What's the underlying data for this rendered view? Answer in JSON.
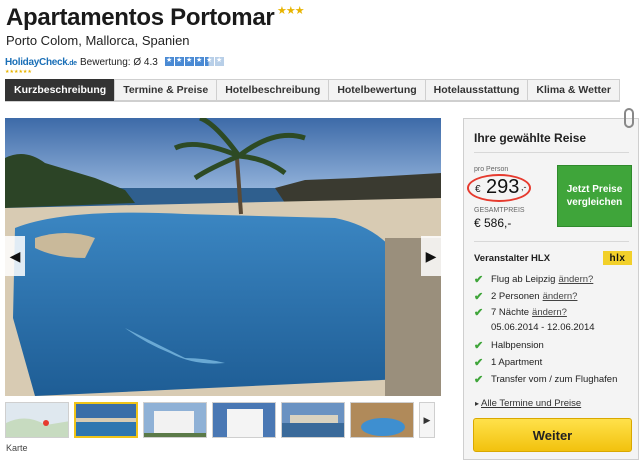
{
  "hotel": {
    "name": "Apartamentos Portomar",
    "stars": "★★★",
    "location": "Porto Colom, Mallorca, Spanien"
  },
  "rating": {
    "logo_text": "HolidayCheck",
    "logo_suffix": ".de",
    "label": "Bewertung: Ø 4.3",
    "value": 4.3,
    "max": 6
  },
  "tabs": [
    {
      "label": "Kurzbeschreibung",
      "active": true
    },
    {
      "label": "Termine & Preise",
      "active": false
    },
    {
      "label": "Hotelbeschreibung",
      "active": false
    },
    {
      "label": "Hotelbewertung",
      "active": false
    },
    {
      "label": "Hotelausstattung",
      "active": false
    },
    {
      "label": "Klima & Wetter",
      "active": false
    }
  ],
  "gallery": {
    "prev_icon": "chevron-left-icon",
    "next_icon": "chevron-right-icon",
    "thumbnail_caption": "Karte",
    "more_icon": "chevron-right-icon"
  },
  "booking": {
    "title": "Ihre gewählte Reise",
    "per_person_label": "pro Person",
    "currency": "€",
    "price_per_person": "293",
    "price_cents": ",-",
    "total_label": "GESAMTPREIS",
    "total_value": "€ 586,-",
    "compare_button": "Jetzt Preise vergleichen",
    "organizer_label": "Veranstalter HLX",
    "organizer_logo": "hlx",
    "features": [
      {
        "text": "Flug ab Leipzig",
        "change": "ändern?"
      },
      {
        "text": "2 Personen",
        "change": "ändern?"
      },
      {
        "text": "7 Nächte",
        "change": "ändern?"
      },
      {
        "text": "Halbpension",
        "change": ""
      },
      {
        "text": "1 Apartment",
        "change": ""
      },
      {
        "text": "Transfer vom / zum Flughafen",
        "change": ""
      }
    ],
    "date_range": "05.06.2014 - 12.06.2014",
    "all_dates_link": "Alle Termine und Preise",
    "continue_button": "Weiter"
  },
  "colors": {
    "accent_green": "#3fa53a",
    "price_circle": "#e63a2e",
    "button_yellow": "#f2c20e",
    "tab_active": "#333333",
    "link_blue": "#1a6fb7"
  }
}
